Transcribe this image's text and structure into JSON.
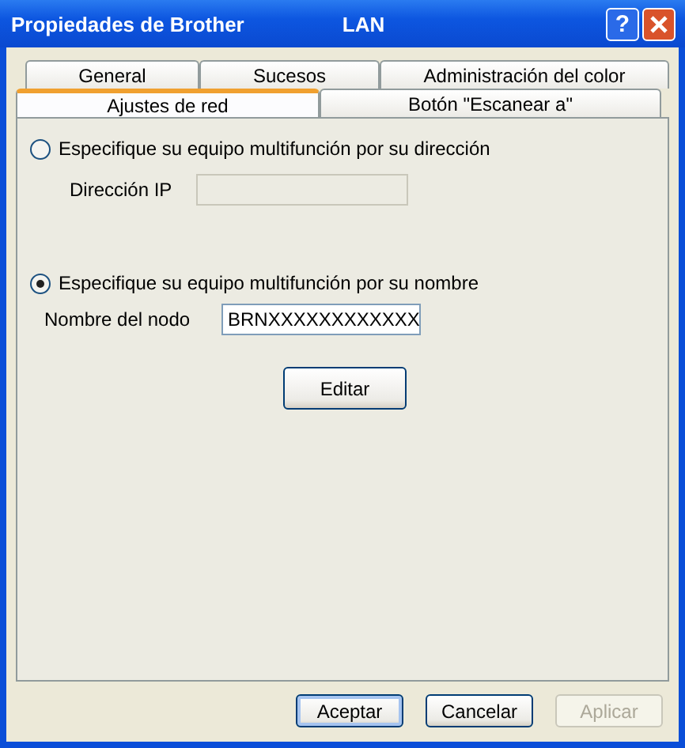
{
  "window": {
    "title": "Propiedades de Brother",
    "subtitle": "LAN",
    "help": "?"
  },
  "tab_rows": [
    [
      {
        "label": "General",
        "selected": false
      },
      {
        "label": "Sucesos",
        "selected": false
      },
      {
        "label": "Administración del color",
        "selected": false
      }
    ],
    [
      {
        "label": "Ajustes de red",
        "selected": true
      },
      {
        "label": "Botón \"Escanear a\"",
        "selected": false
      }
    ]
  ],
  "options": [
    {
      "label": "Especifique su equipo multifunción por su dirección",
      "selected": false,
      "field": {
        "label": "Dirección IP",
        "disabled": true
      }
    },
    {
      "label": "Especifique su equipo multifunción por su nombre",
      "selected": true,
      "field": {
        "label": "Nombre del nodo",
        "value": "BRNXXXXXXXXXXXX",
        "disabled": false
      }
    }
  ],
  "edit_button": "Editar",
  "buttons": [
    {
      "label": "Aceptar",
      "default": true,
      "disabled": false
    },
    {
      "label": "Cancelar",
      "default": false,
      "disabled": false
    },
    {
      "label": "Aplicar",
      "default": false,
      "disabled": true
    }
  ]
}
